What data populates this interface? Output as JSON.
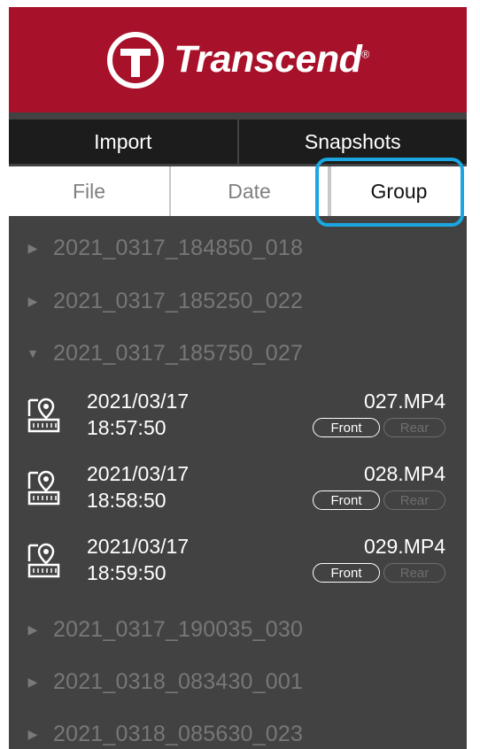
{
  "brand": {
    "name": "Transcend",
    "reg": "®"
  },
  "tabs_top": [
    {
      "label": "Import"
    },
    {
      "label": "Snapshots"
    }
  ],
  "tabs_sort": [
    {
      "label": "File"
    },
    {
      "label": "Date"
    },
    {
      "label": "Group",
      "active": true
    }
  ],
  "groups_before": [
    {
      "name": "2021_0317_184850_018",
      "expanded": false
    },
    {
      "name": "2021_0317_185250_022",
      "expanded": false
    },
    {
      "name": "2021_0317_185750_027",
      "expanded": true
    }
  ],
  "files": [
    {
      "date": "2021/03/17",
      "time": "18:57:50",
      "name": "027.MP4",
      "front": "Front",
      "rear": "Rear"
    },
    {
      "date": "2021/03/17",
      "time": "18:58:50",
      "name": "028.MP4",
      "front": "Front",
      "rear": "Rear"
    },
    {
      "date": "2021/03/17",
      "time": "18:59:50",
      "name": "029.MP4",
      "front": "Front",
      "rear": "Rear"
    }
  ],
  "groups_after": [
    {
      "name": "2021_0317_190035_030",
      "expanded": false
    },
    {
      "name": "2021_0318_083430_001",
      "expanded": false
    },
    {
      "name": "2021_0318_085630_023",
      "expanded": false
    }
  ],
  "icons": {
    "collapsed": "triangle-right-icon",
    "expanded": "triangle-down-icon",
    "file": "video-location-icon"
  },
  "colors": {
    "header": "#a8112a",
    "panel": "#424242",
    "tab_bar": "#1c1c1c",
    "highlight": "#1aa6e0"
  }
}
